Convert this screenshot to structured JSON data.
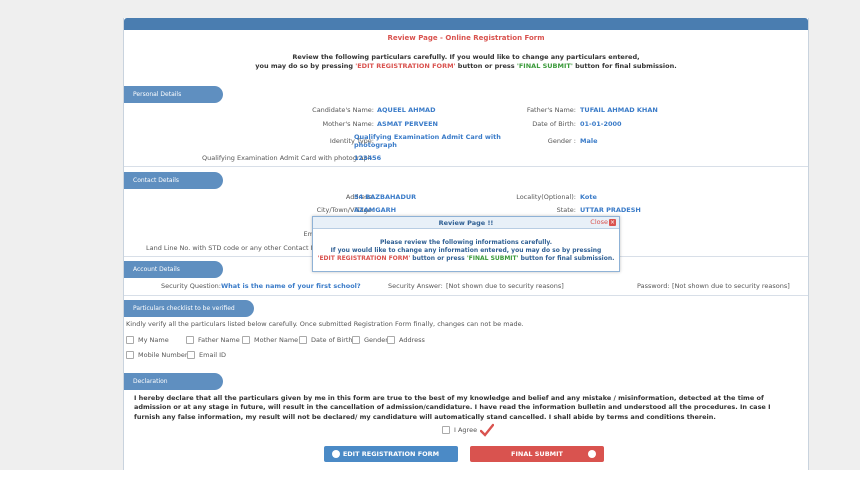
{
  "form": {
    "title": "Review Page - Online Registration Form",
    "intro_line1": "Review the following particulars carefully. If you would like to change any particulars entered,",
    "intro_line2_a": "you may do so by pressing ",
    "intro_line2_edit": "'EDIT REGISTRATION FORM'",
    "intro_line2_b": " button or press ",
    "intro_line2_final": "'FINAL SUBMIT'",
    "intro_line2_c": " button for final submission."
  },
  "sections": {
    "personal": "Personal Details",
    "contact": "Contact Details",
    "account": "Account Details",
    "checklist": "Particulars checklist to be verified",
    "declaration": "Declaration"
  },
  "personal": {
    "candidate_name_label": "Candidate's Name:",
    "candidate_name": "AQUEEL AHMAD",
    "father_name_label": "Father's Name:",
    "father_name": "TUFAIL AHMAD KHAN",
    "mother_name_label": "Mother's Name:",
    "mother_name": "ASMAT PERVEEN",
    "dob_label": "Date of Birth:",
    "dob": "01-01-2000",
    "identity_type_label": "Identity Type:",
    "identity_type_line1": "Qualifying Examination Admit Card with",
    "identity_type_line2": "photograph",
    "gender_label": "Gender :",
    "gender": "Male",
    "admit_card_label": "Qualifying Examination Admit Card with photograph:",
    "admit_card": "123456"
  },
  "contact": {
    "address_label": "Address:",
    "address": "54 BAZBAHADUR",
    "locality_label": "Locality(Optional):",
    "locality": "Kote",
    "city_label": "City/Town/Village:",
    "city": "AZAMGARH",
    "state_label": "State:",
    "state": "UTTAR PRADESH",
    "email_label_partial": "Em",
    "landline_label_partial": "Land Line No. with STD code or any other Contact No"
  },
  "account": {
    "sq_label": "Security Question:",
    "sq": "What is the name of your first school?",
    "sa_label": "Security Answer:",
    "sa": "[Not shown due to security reasons]",
    "pw_label": "Password:",
    "pw": "[Not shown due to security reasons]"
  },
  "checklist": {
    "instruction": "Kindly verify all the particulars listed below carefully. Once submitted Registration Form finally, changes can not be made.",
    "items": [
      "My Name",
      "Father Name",
      "Mother Name",
      "Date of Birth",
      "Gender",
      "Address",
      "Mobile Number",
      "Email ID"
    ]
  },
  "declaration": {
    "text": "I hereby declare that all the particulars given by me in this form are true to the best of my knowledge and belief and any mistake / misinformation, detected at the time of admission or at any stage in future, will result in the cancellation of admission/candidature. I have read the information bulletin and understood all the procedures. In case I furnish any false information, my result will not be declared/ my candidature will automatically stand cancelled. I shall abide by terms and conditions therein.",
    "agree_label": "I Agree"
  },
  "buttons": {
    "edit": "EDIT REGISTRATION FORM",
    "final": "FINAL SUBMIT"
  },
  "modal": {
    "title": "Review Page !!",
    "close": "Close",
    "line1": "Please review the following informations carefully.",
    "line2": "If you would like to change any information entered, you may do so by pressing",
    "line3_edit": "'EDIT REGISTRATION FORM'",
    "line3_a": " button or press ",
    "line3_final": "'FINAL SUBMIT'",
    "line3_b": " button for final submission."
  },
  "colors": {
    "accent": "#4a7db0",
    "value": "#3a7bc8",
    "warn": "#d9534f",
    "ok": "#3a9a3a"
  }
}
